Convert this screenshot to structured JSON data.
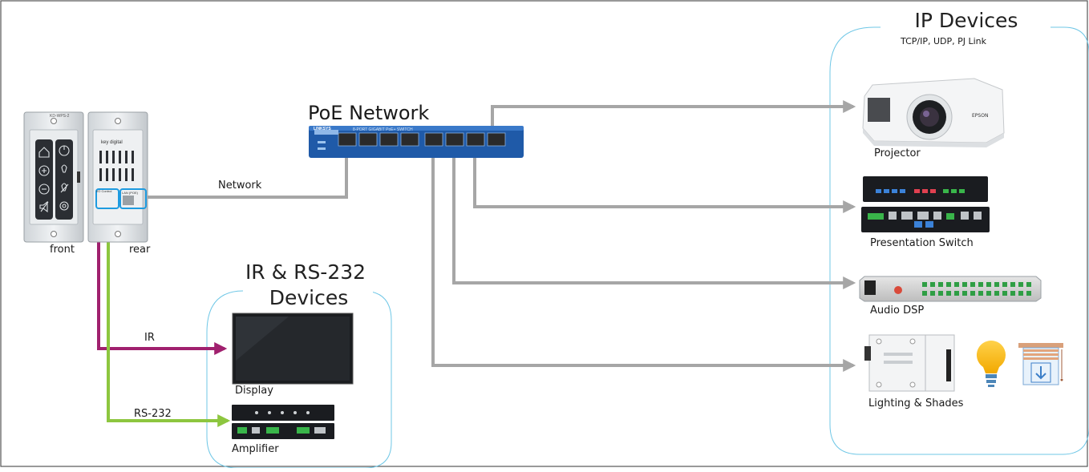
{
  "network": {
    "title": "PoE Network",
    "switch_brand": "LINKSYS",
    "switch_model": "8-PORT GIGABIT PoE+ SWITCH"
  },
  "keypad": {
    "front_label": "front",
    "rear_label": "rear",
    "front_model": "KD-WPS-2",
    "rear_brand": "key digital",
    "rear_io_label": "I/O Control",
    "rear_lan_label": "LAN (POE)",
    "link_label": "Network"
  },
  "ir_rs232": {
    "title_line1": "IR & RS-232",
    "title_line2": "Devices",
    "ir_label": "IR",
    "rs232_label": "RS-232",
    "display_label": "Display",
    "amplifier_label": "Amplifier"
  },
  "ip_devices": {
    "title": "IP Devices",
    "subtitle": "TCP/IP, UDP, PJ Link",
    "projector_label": "Projector",
    "projector_brand": "EPSON",
    "switch_label": "Presentation Switch",
    "dsp_label": "Audio DSP",
    "lighting_label": "Lighting & Shades"
  },
  "colors": {
    "network_line": "#a6a6a6",
    "ir_line": "#a0206e",
    "rs232_line": "#8dc63f",
    "group_border": "#6fc7e6",
    "highlight": "#1e9be0"
  }
}
